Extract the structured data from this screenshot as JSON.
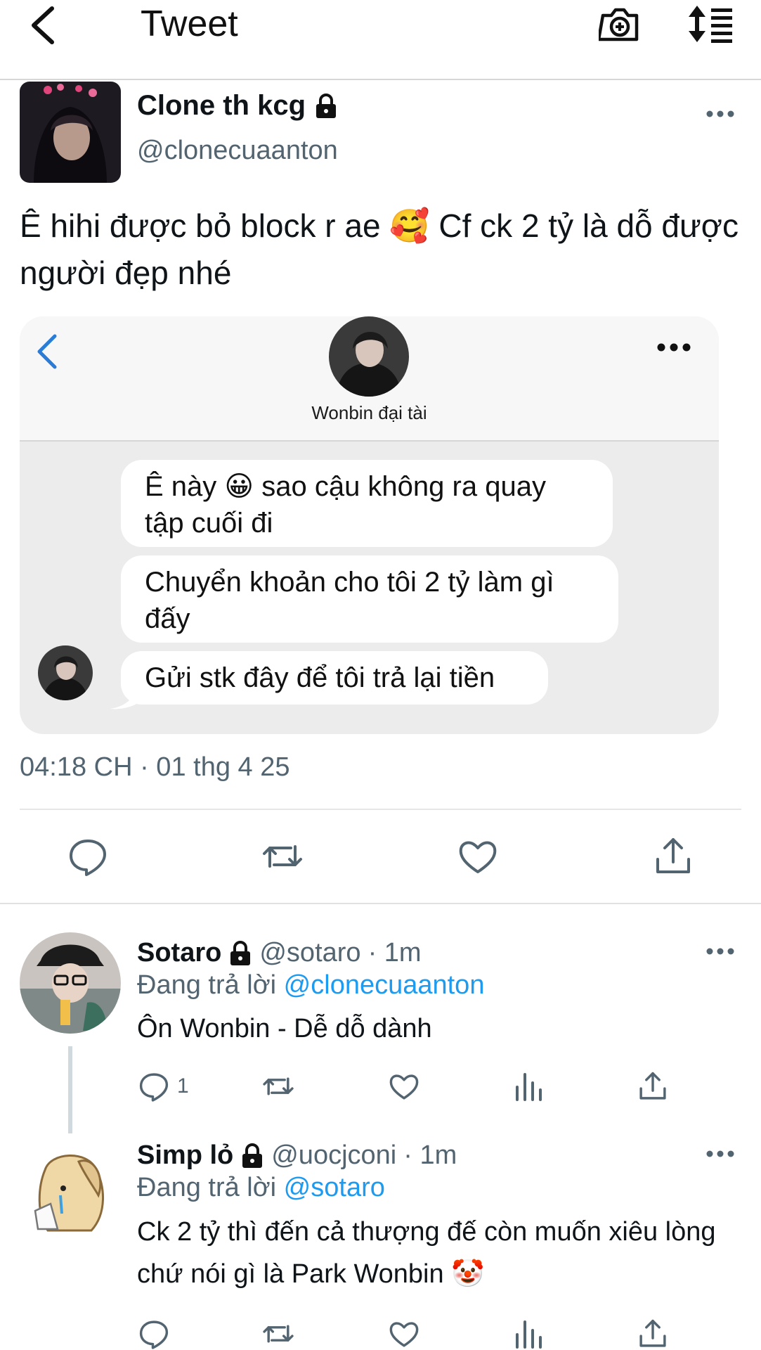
{
  "header": {
    "title": "Tweet",
    "back_icon": "back-chevron-icon",
    "camera_icon": "camera-plus-icon",
    "sort_icon": "sort-list-icon"
  },
  "tweet": {
    "author_name": "Clone th kcg",
    "author_handle": "@clonecuaanton",
    "text": "Ê hihi được bỏ block r ae 🥰 Cf ck 2 tỷ là dỗ được người đẹp nhé",
    "timestamp": "04:18 CH · 01 thg 4 25",
    "attached_chat": {
      "contact_name": "Wonbin đại tài",
      "messages": [
        "Ê này 😀 sao cậu không ra quay tập cuối đi",
        "Chuyển khoản cho tôi 2 tỷ làm gì đấy",
        "Gửi stk đây để tôi trả lại tiền"
      ]
    },
    "actions": [
      "reply-icon",
      "retweet-icon",
      "like-icon",
      "share-icon"
    ]
  },
  "replies": [
    {
      "name": "Sotaro",
      "handle": "@sotaro",
      "time": "· 1m",
      "replying_prefix": "Đang trả lời",
      "replying_to": "@clonecuaanton",
      "text": "Ôn Wonbin - Dễ dỗ dành",
      "reply_count": "1"
    },
    {
      "name": "Simp lỏ",
      "handle": "@uocjconi",
      "time": "· 1m",
      "replying_prefix": "Đang trả lời",
      "replying_to": "@sotaro",
      "text": "Ck 2 tỷ thì đến cả thượng đế còn muốn xiêu lòng chứ nói gì là Park Wonbin 🤡",
      "reply_count": ""
    }
  ],
  "colors": {
    "link": "#1d9bf0",
    "secondary": "#536471",
    "card_back": "#2a7cd6"
  }
}
